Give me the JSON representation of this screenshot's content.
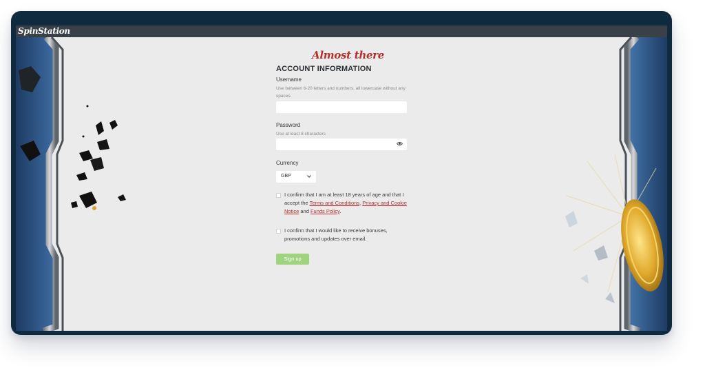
{
  "app": {
    "logo_text": "SpinStation"
  },
  "form": {
    "headline": "Almost there",
    "section_title": "ACCOUNT INFORMATION",
    "username": {
      "label": "Username",
      "hint": "Use between 6-20 letters and numbers, all lowercase without any spaces.",
      "value": "",
      "placeholder": ""
    },
    "password": {
      "label": "Password",
      "hint": "Use at least 8 characters",
      "value": "",
      "placeholder": "",
      "toggle_icon": "eye-icon"
    },
    "currency": {
      "label": "Currency",
      "selected": "GBP",
      "icon": "chevron-down-icon"
    },
    "age_consent": {
      "checked": false,
      "text_prefix": "I confirm that I am at least 18 years of age and that I accept the ",
      "link_terms": "Terms and Conditions",
      "sep1": ", ",
      "link_privacy": "Privacy and Cookie Notice",
      "sep2": " and ",
      "link_funds": "Funds Policy",
      "text_suffix": "."
    },
    "marketing_consent": {
      "checked": false,
      "text": "I confirm that I would like to receive bonuses, promotions and updates over email."
    },
    "submit_label": "Sign up"
  },
  "colors": {
    "accent_red": "#b5302c",
    "button_green": "#9fd37d",
    "topbar": "#3a4047",
    "frame": "#0f2a3f",
    "background": "#ebebeb"
  }
}
